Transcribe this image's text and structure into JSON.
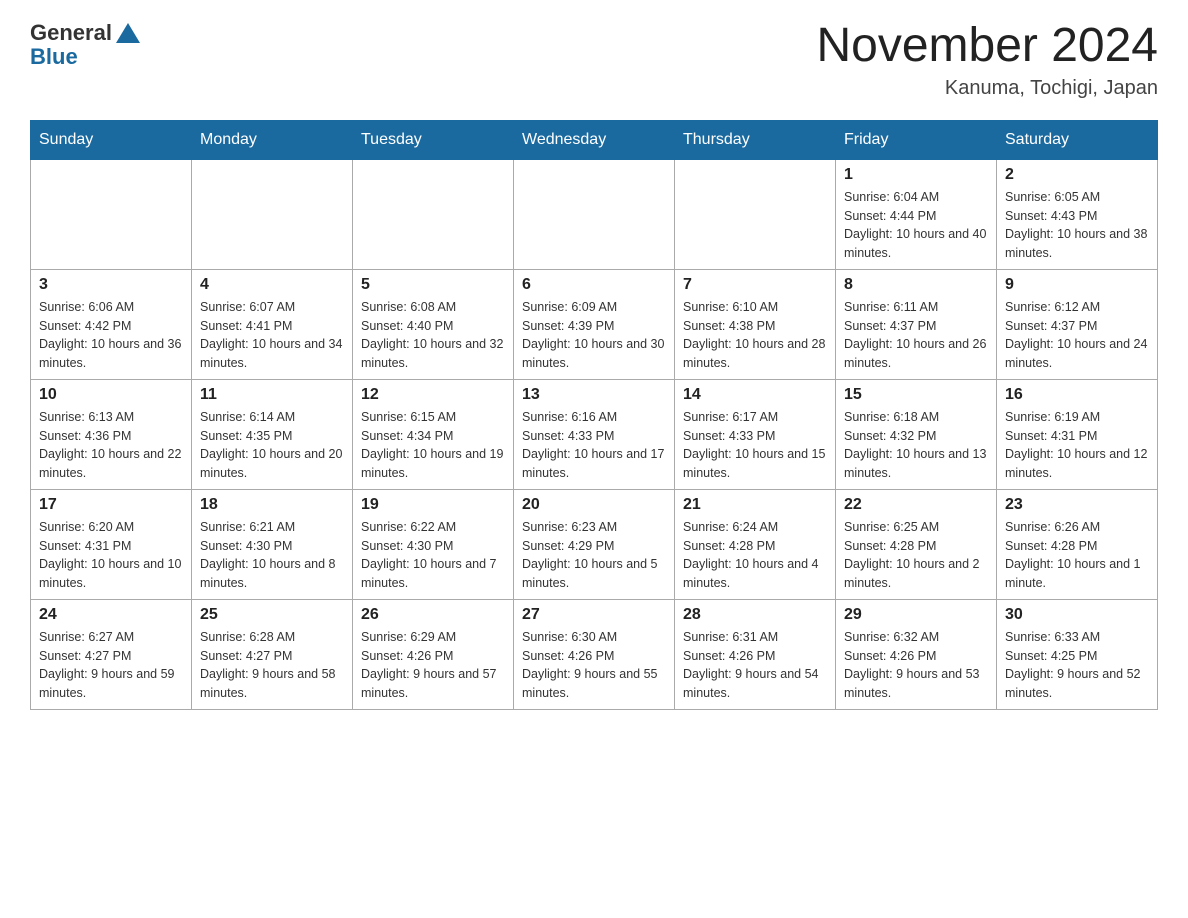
{
  "header": {
    "logo_general": "General",
    "logo_blue": "Blue",
    "month_year": "November 2024",
    "location": "Kanuma, Tochigi, Japan"
  },
  "weekdays": [
    "Sunday",
    "Monday",
    "Tuesday",
    "Wednesday",
    "Thursday",
    "Friday",
    "Saturday"
  ],
  "weeks": [
    [
      {
        "day": "",
        "info": ""
      },
      {
        "day": "",
        "info": ""
      },
      {
        "day": "",
        "info": ""
      },
      {
        "day": "",
        "info": ""
      },
      {
        "day": "",
        "info": ""
      },
      {
        "day": "1",
        "info": "Sunrise: 6:04 AM\nSunset: 4:44 PM\nDaylight: 10 hours and 40 minutes."
      },
      {
        "day": "2",
        "info": "Sunrise: 6:05 AM\nSunset: 4:43 PM\nDaylight: 10 hours and 38 minutes."
      }
    ],
    [
      {
        "day": "3",
        "info": "Sunrise: 6:06 AM\nSunset: 4:42 PM\nDaylight: 10 hours and 36 minutes."
      },
      {
        "day": "4",
        "info": "Sunrise: 6:07 AM\nSunset: 4:41 PM\nDaylight: 10 hours and 34 minutes."
      },
      {
        "day": "5",
        "info": "Sunrise: 6:08 AM\nSunset: 4:40 PM\nDaylight: 10 hours and 32 minutes."
      },
      {
        "day": "6",
        "info": "Sunrise: 6:09 AM\nSunset: 4:39 PM\nDaylight: 10 hours and 30 minutes."
      },
      {
        "day": "7",
        "info": "Sunrise: 6:10 AM\nSunset: 4:38 PM\nDaylight: 10 hours and 28 minutes."
      },
      {
        "day": "8",
        "info": "Sunrise: 6:11 AM\nSunset: 4:37 PM\nDaylight: 10 hours and 26 minutes."
      },
      {
        "day": "9",
        "info": "Sunrise: 6:12 AM\nSunset: 4:37 PM\nDaylight: 10 hours and 24 minutes."
      }
    ],
    [
      {
        "day": "10",
        "info": "Sunrise: 6:13 AM\nSunset: 4:36 PM\nDaylight: 10 hours and 22 minutes."
      },
      {
        "day": "11",
        "info": "Sunrise: 6:14 AM\nSunset: 4:35 PM\nDaylight: 10 hours and 20 minutes."
      },
      {
        "day": "12",
        "info": "Sunrise: 6:15 AM\nSunset: 4:34 PM\nDaylight: 10 hours and 19 minutes."
      },
      {
        "day": "13",
        "info": "Sunrise: 6:16 AM\nSunset: 4:33 PM\nDaylight: 10 hours and 17 minutes."
      },
      {
        "day": "14",
        "info": "Sunrise: 6:17 AM\nSunset: 4:33 PM\nDaylight: 10 hours and 15 minutes."
      },
      {
        "day": "15",
        "info": "Sunrise: 6:18 AM\nSunset: 4:32 PM\nDaylight: 10 hours and 13 minutes."
      },
      {
        "day": "16",
        "info": "Sunrise: 6:19 AM\nSunset: 4:31 PM\nDaylight: 10 hours and 12 minutes."
      }
    ],
    [
      {
        "day": "17",
        "info": "Sunrise: 6:20 AM\nSunset: 4:31 PM\nDaylight: 10 hours and 10 minutes."
      },
      {
        "day": "18",
        "info": "Sunrise: 6:21 AM\nSunset: 4:30 PM\nDaylight: 10 hours and 8 minutes."
      },
      {
        "day": "19",
        "info": "Sunrise: 6:22 AM\nSunset: 4:30 PM\nDaylight: 10 hours and 7 minutes."
      },
      {
        "day": "20",
        "info": "Sunrise: 6:23 AM\nSunset: 4:29 PM\nDaylight: 10 hours and 5 minutes."
      },
      {
        "day": "21",
        "info": "Sunrise: 6:24 AM\nSunset: 4:28 PM\nDaylight: 10 hours and 4 minutes."
      },
      {
        "day": "22",
        "info": "Sunrise: 6:25 AM\nSunset: 4:28 PM\nDaylight: 10 hours and 2 minutes."
      },
      {
        "day": "23",
        "info": "Sunrise: 6:26 AM\nSunset: 4:28 PM\nDaylight: 10 hours and 1 minute."
      }
    ],
    [
      {
        "day": "24",
        "info": "Sunrise: 6:27 AM\nSunset: 4:27 PM\nDaylight: 9 hours and 59 minutes."
      },
      {
        "day": "25",
        "info": "Sunrise: 6:28 AM\nSunset: 4:27 PM\nDaylight: 9 hours and 58 minutes."
      },
      {
        "day": "26",
        "info": "Sunrise: 6:29 AM\nSunset: 4:26 PM\nDaylight: 9 hours and 57 minutes."
      },
      {
        "day": "27",
        "info": "Sunrise: 6:30 AM\nSunset: 4:26 PM\nDaylight: 9 hours and 55 minutes."
      },
      {
        "day": "28",
        "info": "Sunrise: 6:31 AM\nSunset: 4:26 PM\nDaylight: 9 hours and 54 minutes."
      },
      {
        "day": "29",
        "info": "Sunrise: 6:32 AM\nSunset: 4:26 PM\nDaylight: 9 hours and 53 minutes."
      },
      {
        "day": "30",
        "info": "Sunrise: 6:33 AM\nSunset: 4:25 PM\nDaylight: 9 hours and 52 minutes."
      }
    ]
  ]
}
